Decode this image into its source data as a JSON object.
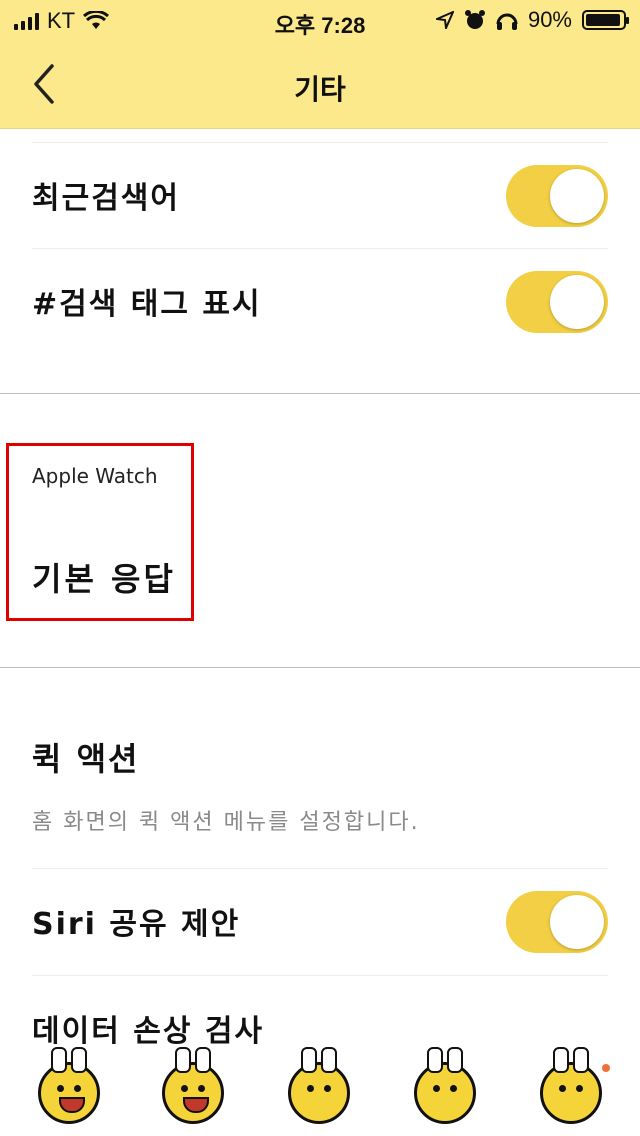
{
  "status_bar": {
    "carrier": "KT",
    "time": "오후 7:28",
    "battery": "90%"
  },
  "nav": {
    "title": "기타",
    "back_icon": "chevron-left-icon"
  },
  "settings": [
    {
      "label": "최근검색어",
      "toggle_on": true
    },
    {
      "label": "#검색 태그 표시",
      "toggle_on": true
    }
  ],
  "apple_watch": {
    "caption": "Apple Watch",
    "basic_reply": "기본 응답"
  },
  "quick_action": {
    "title": "퀵 액션",
    "description": "홈 화면의 퀵 액션 메뉴를 설정합니다."
  },
  "siri": {
    "label": "Siri 공유 제안",
    "toggle_on": true
  },
  "data_check": {
    "label": "데이터 손상 검사"
  },
  "colors": {
    "accent_yellow": "#fbe98b",
    "toggle_yellow": "#f2cf44",
    "highlight_red": "#e10000"
  },
  "emoji_bar": [
    "emoji-laugh",
    "emoji-heart-laugh",
    "emoji-surprised",
    "emoji-wink",
    "emoji-grumpy"
  ]
}
